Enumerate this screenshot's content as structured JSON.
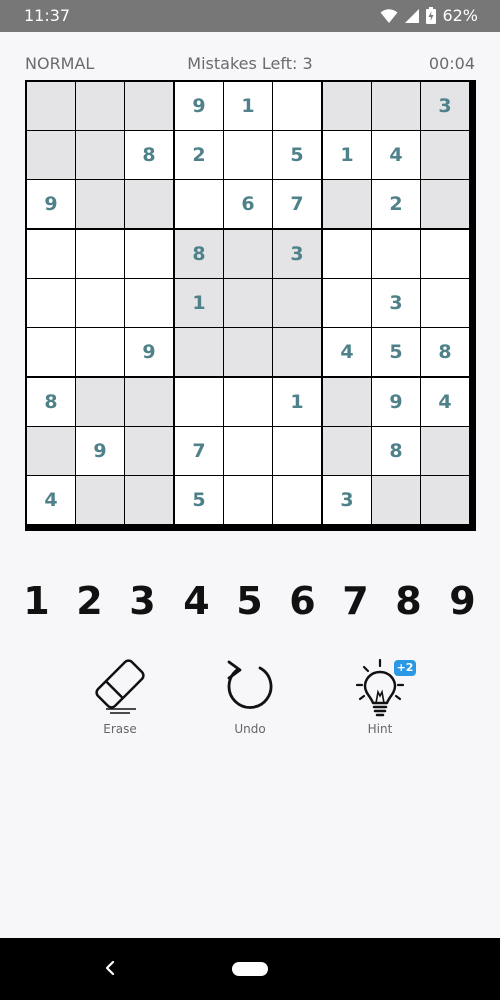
{
  "status_bar": {
    "time": "11:37",
    "battery_percent": "62%"
  },
  "game": {
    "difficulty": "NORMAL",
    "mistakes_text": "Mistakes Left: 3",
    "timer": "00:04"
  },
  "board": {
    "values": [
      [
        "",
        "",
        "",
        "9",
        "1",
        "",
        "",
        "",
        "3"
      ],
      [
        "",
        "",
        "8",
        "2",
        "",
        "5",
        "1",
        "4",
        ""
      ],
      [
        "9",
        "",
        "",
        "",
        "6",
        "7",
        "",
        "2",
        ""
      ],
      [
        "",
        "",
        "",
        "8",
        "",
        "3",
        "",
        "",
        ""
      ],
      [
        "",
        "",
        "",
        "1",
        "",
        "",
        "",
        "3",
        ""
      ],
      [
        "",
        "",
        "9",
        "",
        "",
        "",
        "4",
        "5",
        "8"
      ],
      [
        "8",
        "",
        "",
        "",
        "",
        "1",
        "",
        "9",
        "4"
      ],
      [
        "",
        "9",
        "",
        "7",
        "",
        "",
        "",
        "8",
        ""
      ],
      [
        "4",
        "",
        "",
        "5",
        "",
        "",
        "3",
        "",
        ""
      ]
    ],
    "colors": {
      "given_digit": "#4e8189",
      "shaded_cell": "#e4e4e6",
      "plain_cell": "#ffffff"
    }
  },
  "numpad": {
    "keys": [
      "1",
      "2",
      "3",
      "4",
      "5",
      "6",
      "7",
      "8",
      "9"
    ]
  },
  "tools": {
    "erase": {
      "label": "Erase",
      "icon": "eraser-icon"
    },
    "undo": {
      "label": "Undo",
      "icon": "undo-icon"
    },
    "hint": {
      "label": "Hint",
      "icon": "lightbulb-icon",
      "badge": "+2"
    }
  },
  "accent_color": "#2b98e6"
}
